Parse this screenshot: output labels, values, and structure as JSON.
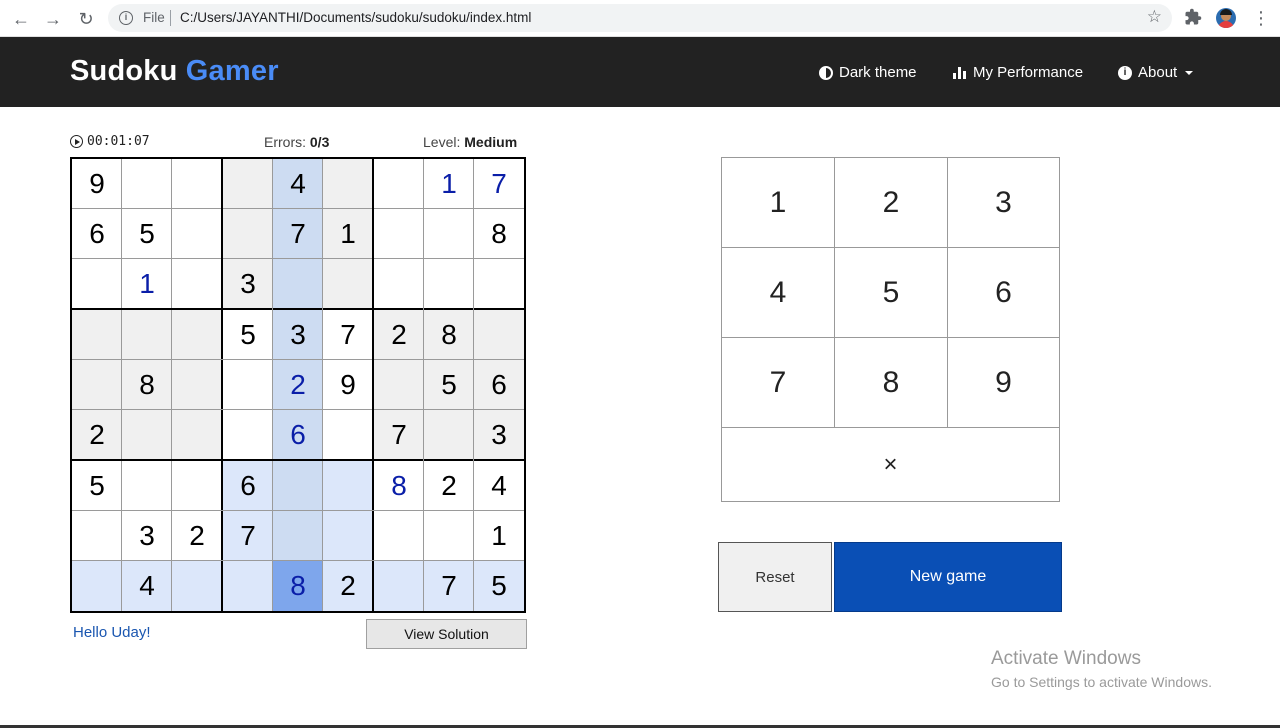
{
  "browser": {
    "file_label": "File",
    "url": "C:/Users/JAYANTHI/Documents/sudoku/sudoku/index.html"
  },
  "brand": {
    "part1": "Sudoku",
    "part2": "Gamer"
  },
  "nav": {
    "dark_theme": "Dark theme",
    "performance": "My Performance",
    "about": "About"
  },
  "status": {
    "timer": "00:01:07",
    "errors_label": "Errors:",
    "errors_value": "0/3",
    "level_label": "Level:",
    "level_value": "Medium"
  },
  "board": {
    "rows": [
      [
        "9",
        "",
        "",
        "",
        "4",
        "",
        "",
        "1",
        "7"
      ],
      [
        "6",
        "5",
        "",
        "",
        "7",
        "1",
        "",
        "",
        "8"
      ],
      [
        "",
        "1",
        "",
        "3",
        "",
        "",
        "",
        "",
        ""
      ],
      [
        "",
        "",
        "",
        "5",
        "3",
        "7",
        "2",
        "8",
        ""
      ],
      [
        "",
        "8",
        "",
        "",
        "2",
        "9",
        "",
        "5",
        "6"
      ],
      [
        "2",
        "",
        "",
        "",
        "6",
        "",
        "7",
        "",
        "3"
      ],
      [
        "5",
        "",
        "",
        "6",
        "",
        "",
        "8",
        "2",
        "4"
      ],
      [
        "",
        "3",
        "2",
        "7",
        "",
        "",
        "",
        "",
        "1"
      ],
      [
        "",
        "4",
        "",
        "",
        "8",
        "2",
        "",
        "7",
        "5"
      ]
    ],
    "user_entries": [
      [
        0,
        7
      ],
      [
        0,
        8
      ],
      [
        2,
        1
      ],
      [
        4,
        4
      ],
      [
        5,
        4
      ],
      [
        6,
        6
      ],
      [
        8,
        4
      ]
    ],
    "selected": [
      8,
      4
    ],
    "colors": {
      "box_shade": "#f0f0f0",
      "related_highlight": "#cddcf2",
      "related_light": "#dce7fa",
      "selected": "#7ea6ec",
      "user_digit": "#0a1ea8"
    }
  },
  "greeting": "Hello Uday!",
  "view_solution": "View Solution",
  "keypad": {
    "digits": [
      "1",
      "2",
      "3",
      "4",
      "5",
      "6",
      "7",
      "8",
      "9"
    ],
    "erase": "×"
  },
  "actions": {
    "reset": "Reset",
    "new_game": "New game"
  },
  "watermark": {
    "line1": "Activate Windows",
    "line2": "Go to Settings to activate Windows."
  }
}
